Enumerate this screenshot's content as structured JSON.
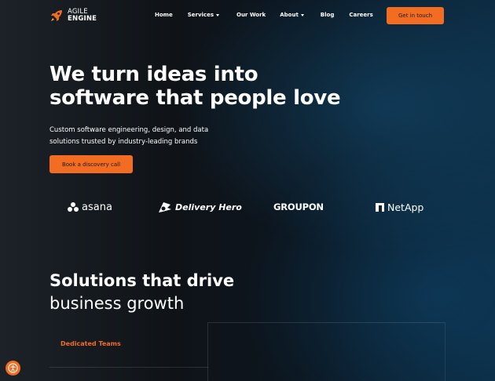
{
  "header": {
    "logo": {
      "line1": "AGILE",
      "line2": "ENGINE",
      "icon": "rocket-logo-icon"
    },
    "nav": [
      {
        "label": "Home",
        "has_dropdown": false
      },
      {
        "label": "Services",
        "has_dropdown": true
      },
      {
        "label": "Our Work",
        "has_dropdown": false
      },
      {
        "label": "About",
        "has_dropdown": true
      },
      {
        "label": "Blog",
        "has_dropdown": false
      },
      {
        "label": "Careers",
        "has_dropdown": false
      }
    ],
    "cta_label": "Get in touch"
  },
  "hero": {
    "title_line1": "We turn ideas into",
    "title_line2": "software that people love",
    "subtitle_line1": "Custom software engineering, design, and data",
    "subtitle_line2": "solutions trusted by industry-leading brands",
    "cta_label": "Book a discovery call"
  },
  "clients": [
    {
      "name": "asana",
      "icon": "asana-dots-icon"
    },
    {
      "name": "Delivery Hero",
      "icon": "delivery-hero-icon"
    },
    {
      "name": "GROUPON",
      "icon": ""
    },
    {
      "name": "NetApp",
      "icon": "netapp-icon"
    }
  ],
  "solutions": {
    "title_line1": "Solutions that drive",
    "title_line2": "business growth",
    "tabs": [
      {
        "label": "Dedicated Teams",
        "active": true
      }
    ]
  },
  "accessibility": {
    "icon": "accessibility-icon"
  },
  "colors": {
    "accent": "#f26c21",
    "background": "#0f1318",
    "text": "#ffffff"
  }
}
